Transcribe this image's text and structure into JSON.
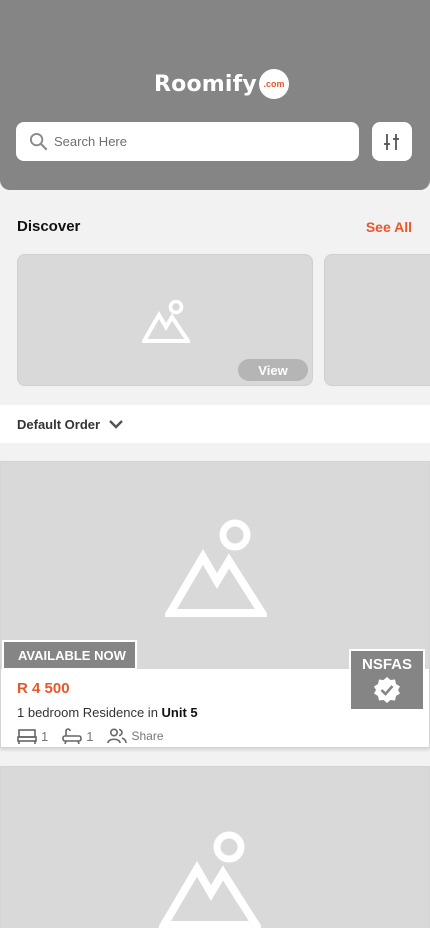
{
  "header": {
    "logo_text": "Roomify",
    "logo_badge": ".com",
    "search_placeholder": "Search Here"
  },
  "discover": {
    "title": "Discover",
    "see_all": "See All",
    "cards": [
      {
        "view_label": "View"
      },
      {
        "view_label": ""
      }
    ]
  },
  "sort": {
    "label": "Default Order"
  },
  "listings": [
    {
      "badge": "AVAILABLE NOW",
      "nsfas_label": "NSFAS",
      "price": "R 4 500",
      "description": "1 bedroom Residence in",
      "unit": "Unit 5",
      "beds": "1",
      "baths": "1",
      "sharing": "Share"
    }
  ],
  "colors": {
    "accent": "#e8572a",
    "header_bg": "#858585",
    "placeholder_bg": "#d9d9d9"
  },
  "icons": [
    "search-icon",
    "filter-icon",
    "image-placeholder-icon",
    "chevron-down-icon",
    "verified-icon",
    "bed-icon",
    "bath-icon",
    "people-icon"
  ]
}
